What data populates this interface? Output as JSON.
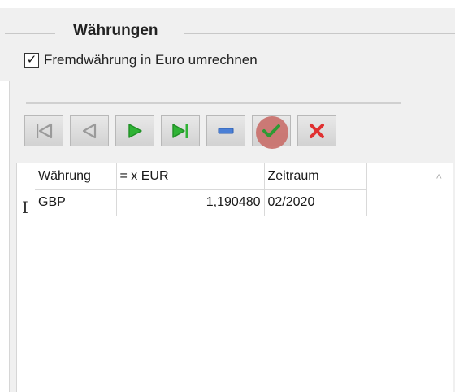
{
  "group": {
    "title": "Währungen",
    "checkbox_label": "Fremdwährung in Euro umrechnen",
    "checkbox_checked": true,
    "check_mark": "✓"
  },
  "toolbar": {
    "buttons": [
      {
        "name": "first-record",
        "icon": "first-record-icon",
        "enabled": false
      },
      {
        "name": "previous-record",
        "icon": "previous-record-icon",
        "enabled": false
      },
      {
        "name": "next-record",
        "icon": "next-record-icon",
        "enabled": true
      },
      {
        "name": "last-record",
        "icon": "last-record-icon",
        "enabled": true
      },
      {
        "name": "delete-record",
        "icon": "minus-icon",
        "enabled": true
      },
      {
        "name": "post-edit",
        "icon": "check-icon",
        "enabled": true,
        "highlighted": true
      },
      {
        "name": "cancel-edit",
        "icon": "cross-icon",
        "enabled": true
      }
    ],
    "colors": {
      "disabled": "#9a9a9a",
      "navigate": "#2fb335",
      "delete": "#4a7fd6",
      "confirm": "#2f9a34",
      "cancel": "#e03030",
      "highlight": "#c9736f"
    }
  },
  "grid": {
    "columns": [
      "Währung",
      "= x EUR",
      "Zeitraum"
    ],
    "rows": [
      {
        "currency": "GBP",
        "rate": "1,190480",
        "period": "02/2020"
      }
    ],
    "row_indicator": "I",
    "scroll_up_glyph": "^"
  }
}
